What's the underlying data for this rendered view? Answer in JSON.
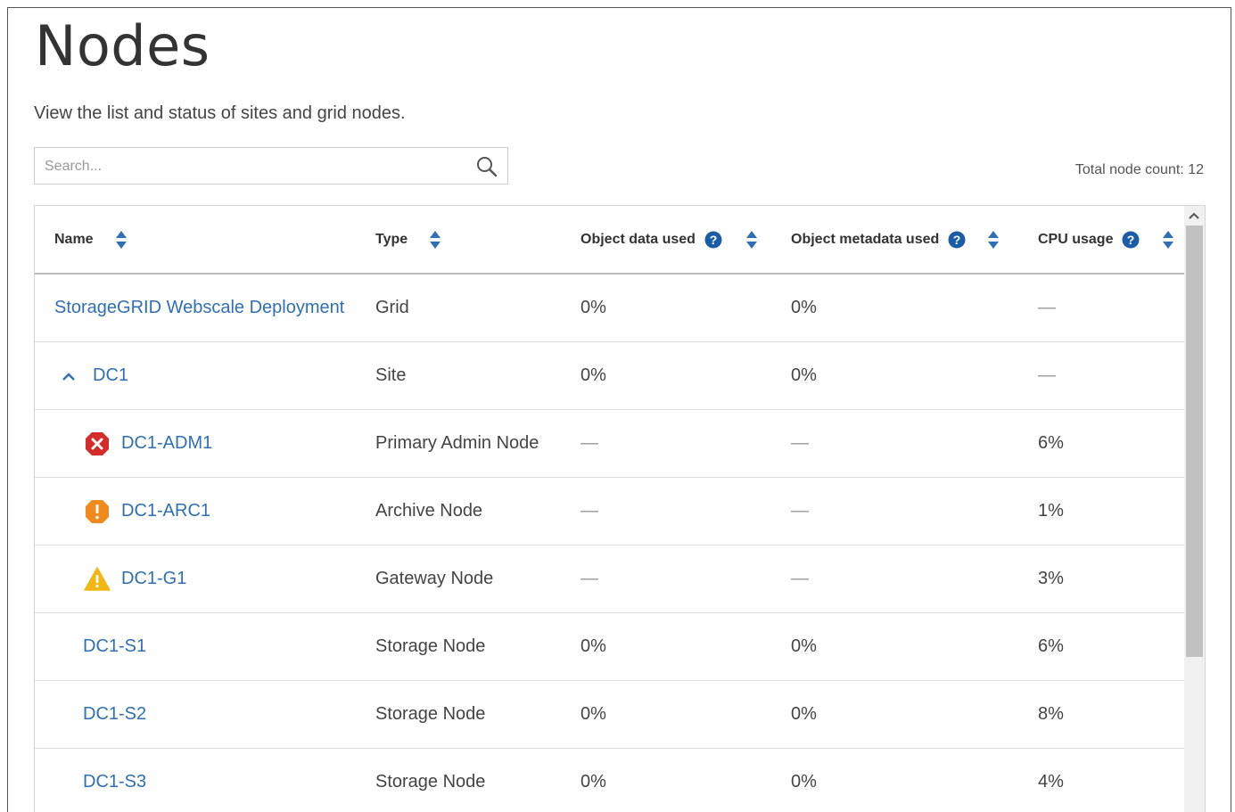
{
  "page": {
    "title": "Nodes",
    "subtitle": "View the list and status of sites and grid nodes."
  },
  "search": {
    "placeholder": "Search...",
    "value": ""
  },
  "summary": {
    "label": "Total node count:",
    "count": "12"
  },
  "table": {
    "columns": [
      {
        "label": "Name",
        "help": false
      },
      {
        "label": "Type",
        "help": false
      },
      {
        "label": "Object data used",
        "help": true
      },
      {
        "label": "Object metadata used",
        "help": true
      },
      {
        "label": "CPU usage",
        "help": true
      }
    ],
    "rows": [
      {
        "name": "StorageGRID Webscale Deployment",
        "type": "Grid",
        "object_data": "0%",
        "object_metadata": "0%",
        "cpu": "—",
        "level": 0,
        "status": "none"
      },
      {
        "name": "DC1",
        "type": "Site",
        "object_data": "0%",
        "object_metadata": "0%",
        "cpu": "—",
        "level": 0,
        "status": "expanded"
      },
      {
        "name": "DC1-ADM1",
        "type": "Primary Admin Node",
        "object_data": "—",
        "object_metadata": "—",
        "cpu": "6%",
        "level": 1,
        "status": "error-icon"
      },
      {
        "name": "DC1-ARC1",
        "type": "Archive Node",
        "object_data": "—",
        "object_metadata": "—",
        "cpu": "1%",
        "level": 1,
        "status": "major-alert-icon"
      },
      {
        "name": "DC1-G1",
        "type": "Gateway Node",
        "object_data": "—",
        "object_metadata": "—",
        "cpu": "3%",
        "level": 1,
        "status": "warning-icon"
      },
      {
        "name": "DC1-S1",
        "type": "Storage Node",
        "object_data": "0%",
        "object_metadata": "0%",
        "cpu": "6%",
        "level": 1,
        "status": "none"
      },
      {
        "name": "DC1-S2",
        "type": "Storage Node",
        "object_data": "0%",
        "object_metadata": "0%",
        "cpu": "8%",
        "level": 1,
        "status": "none"
      },
      {
        "name": "DC1-S3",
        "type": "Storage Node",
        "object_data": "0%",
        "object_metadata": "0%",
        "cpu": "4%",
        "level": 1,
        "status": "none"
      }
    ]
  },
  "colors": {
    "link": "#2f6fb5",
    "help_icon": "#1a5ca8",
    "error": "#d52b2b",
    "major": "#f08a1c",
    "warning": "#f3b715"
  }
}
